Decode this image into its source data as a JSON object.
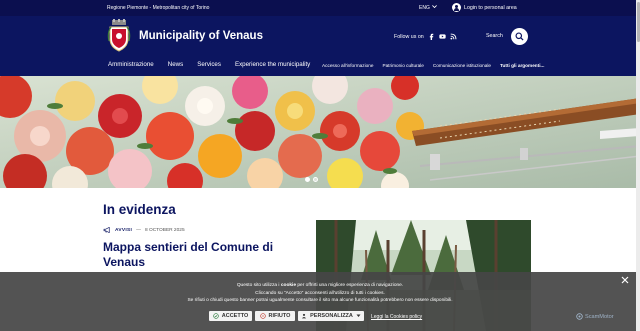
{
  "topbar": {
    "region": "Regione Piemonte - Metropolitan city of Torino",
    "language": "ENG",
    "login": "Login to personal area"
  },
  "header": {
    "title": "Municipality of Venaus",
    "follow_us": "Follow us on",
    "social": [
      "facebook-icon",
      "youtube-icon",
      "rss-icon"
    ],
    "search_label": "Search"
  },
  "main_nav": [
    "Amministrazione",
    "News",
    "Services",
    "Experience the municipality"
  ],
  "sub_nav": [
    "Accesso all'informazione",
    "Patrimonio culturale",
    "Comunicazione istituzionale",
    "Tutti gli argomenti..."
  ],
  "hero": {
    "slides": 2,
    "active_slide": 1
  },
  "content": {
    "section_title": "In evidenza",
    "article": {
      "category": "AVVISI",
      "date": "8 OCTOBER 2025",
      "title": "Mappa sentieri del Comune di Venaus"
    }
  },
  "cookie_banner": {
    "line1_pre": "Questo sito utilizza i",
    "line1_bold": "cookie",
    "line1_post": "per offrirti una migliore esperienza di navigazione.",
    "line2": "Cliccando su \"Accetto\" acconsenti all'utilizzo di tutti i cookies.",
    "line3": "Se rifiuti o chiudi questo banner potrai ugualmente consultare il sito ma alcune funzionalità potrebbero non essere disponibili.",
    "accept": "ACCETTO",
    "reject": "RIFIUTO",
    "customize": "PERSONALIZZA",
    "policy_link": "Leggi la Cookies policy",
    "brand": "ScamMotor"
  },
  "colors": {
    "header_bg": "#0c1560",
    "topbar_bg": "#0b0f4f",
    "primary_text": "#0c1560",
    "cookie_bg": "#464646"
  }
}
